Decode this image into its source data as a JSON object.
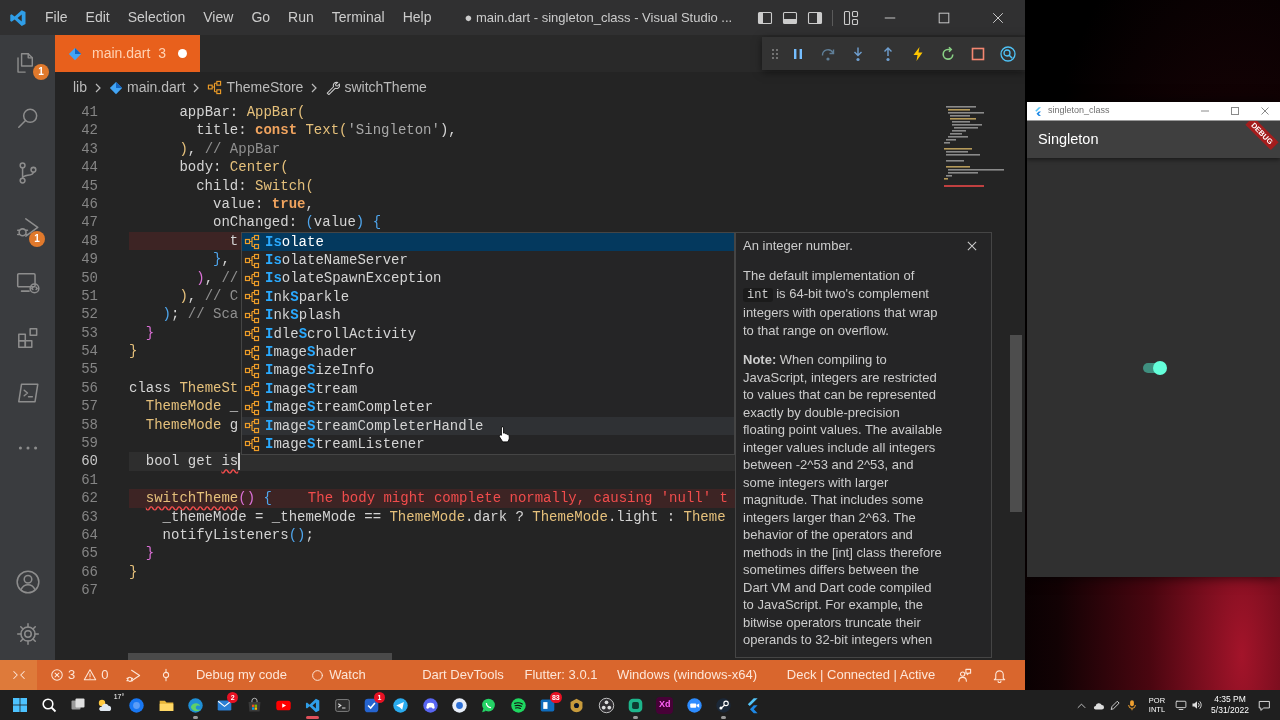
{
  "title_bar": {
    "menu": [
      "File",
      "Edit",
      "Selection",
      "View",
      "Go",
      "Run",
      "Terminal",
      "Help"
    ],
    "title": "● main.dart - singleton_class - Visual Studio ..."
  },
  "activity_bar": {
    "explorer_badge": "1",
    "debug_badge": "1"
  },
  "tabs": [
    {
      "label": "main.dart",
      "problems": "3",
      "modified": true,
      "selected": true
    }
  ],
  "breadcrumb": [
    {
      "label": "lib",
      "kind": "folder"
    },
    {
      "label": "main.dart",
      "kind": "file"
    },
    {
      "label": "ThemeStore",
      "kind": "class"
    },
    {
      "label": "switchTheme",
      "kind": "method"
    }
  ],
  "editor": {
    "lines": [
      {
        "number": "41",
        "current": false,
        "error": false,
        "tokens": [
          {
            "text": "      appBar: ",
            "kind": "plain"
          },
          {
            "text": "AppBar(",
            "kind": "type"
          }
        ]
      },
      {
        "number": "42",
        "current": false,
        "error": false,
        "tokens": [
          {
            "text": "        title: ",
            "kind": "plain"
          },
          {
            "text": "const",
            "kind": "keyword"
          },
          {
            "text": " Text(",
            "kind": "type"
          },
          {
            "text": "'Singleton'",
            "kind": "string"
          },
          {
            "text": "),",
            "kind": "plain"
          }
        ]
      },
      {
        "number": "43",
        "current": false,
        "error": false,
        "tokens": [
          {
            "text": "      )",
            "kind": "bracket_gold"
          },
          {
            "text": ", ",
            "kind": "plain"
          },
          {
            "text": "// AppBar",
            "kind": "comment"
          }
        ]
      },
      {
        "number": "44",
        "current": false,
        "error": false,
        "tokens": [
          {
            "text": "      body: ",
            "kind": "plain"
          },
          {
            "text": "Center(",
            "kind": "type"
          }
        ]
      },
      {
        "number": "45",
        "current": false,
        "error": false,
        "tokens": [
          {
            "text": "        child: ",
            "kind": "plain"
          },
          {
            "text": "Switch(",
            "kind": "type"
          }
        ]
      },
      {
        "number": "46",
        "current": false,
        "error": false,
        "tokens": [
          {
            "text": "          value: ",
            "kind": "plain"
          },
          {
            "text": "true",
            "kind": "keyword"
          },
          {
            "text": ",",
            "kind": "plain"
          }
        ]
      },
      {
        "number": "47",
        "current": false,
        "error": false,
        "tokens": [
          {
            "text": "          onChanged: ",
            "kind": "plain"
          },
          {
            "text": "(",
            "kind": "bracket_blue"
          },
          {
            "text": "value",
            "kind": "plain"
          },
          {
            "text": ") {",
            "kind": "bracket_blue"
          }
        ]
      },
      {
        "number": "48",
        "current": false,
        "error": true,
        "tokens": [
          {
            "text": "            t",
            "kind": "plain"
          }
        ]
      },
      {
        "number": "49",
        "current": false,
        "error": false,
        "tokens": [
          {
            "text": "          }",
            "kind": "bracket_blue"
          },
          {
            "text": ",",
            "kind": "plain"
          }
        ]
      },
      {
        "number": "50",
        "current": false,
        "error": false,
        "tokens": [
          {
            "text": "        )",
            "kind": "bracket_pink"
          },
          {
            "text": ", ",
            "kind": "plain"
          },
          {
            "text": "//",
            "kind": "comment"
          }
        ]
      },
      {
        "number": "51",
        "current": false,
        "error": false,
        "tokens": [
          {
            "text": "      )",
            "kind": "bracket_gold"
          },
          {
            "text": ", ",
            "kind": "plain"
          },
          {
            "text": "// C",
            "kind": "comment"
          }
        ]
      },
      {
        "number": "52",
        "current": false,
        "error": false,
        "tokens": [
          {
            "text": "    )",
            "kind": "bracket_blue"
          },
          {
            "text": "; ",
            "kind": "plain"
          },
          {
            "text": "// Sca",
            "kind": "comment"
          }
        ]
      },
      {
        "number": "53",
        "current": false,
        "error": false,
        "tokens": [
          {
            "text": "  }",
            "kind": "bracket_pink"
          }
        ]
      },
      {
        "number": "54",
        "current": false,
        "error": false,
        "tokens": [
          {
            "text": "}",
            "kind": "bracket_gold"
          }
        ]
      },
      {
        "number": "55",
        "current": false,
        "error": false
      },
      {
        "number": "56",
        "current": false,
        "error": false,
        "tokens": [
          {
            "text": "class ",
            "kind": "plain"
          },
          {
            "text": "ThemeSt",
            "kind": "type"
          }
        ]
      },
      {
        "number": "57",
        "current": false,
        "error": false,
        "tokens": [
          {
            "text": "  ThemeMode",
            "kind": "type"
          },
          {
            "text": " _",
            "kind": "plain"
          }
        ]
      },
      {
        "number": "58",
        "current": false,
        "error": false,
        "tokens": [
          {
            "text": "  ThemeMode",
            "kind": "type"
          },
          {
            "text": " g",
            "kind": "plain"
          }
        ]
      },
      {
        "number": "59",
        "current": false,
        "error": false
      },
      {
        "number": "60",
        "current": true,
        "error": false,
        "tokens": [
          {
            "text": "  bool get ",
            "kind": "plain"
          },
          {
            "text": "is",
            "kind": "error_ident"
          }
        ]
      },
      {
        "number": "61",
        "current": false,
        "error": false
      },
      {
        "number": "62",
        "current": false,
        "error": true,
        "tokens": [
          {
            "text": "  switchTheme",
            "kind": "error_call"
          },
          {
            "text": "()",
            "kind": "bracket_pink"
          },
          {
            "text": " {",
            "kind": "bracket_blue"
          }
        ],
        "diagnostic": "The body might complete normally, causing 'null' t"
      },
      {
        "number": "63",
        "current": false,
        "error": false,
        "tokens": [
          {
            "text": "    _themeMode = _themeMode == ",
            "kind": "plain"
          },
          {
            "text": "ThemeMode",
            "kind": "type"
          },
          {
            "text": ".dark ? ",
            "kind": "plain"
          },
          {
            "text": "ThemeMode",
            "kind": "type"
          },
          {
            "text": ".light : ",
            "kind": "plain"
          },
          {
            "text": "Theme",
            "kind": "type"
          }
        ]
      },
      {
        "number": "64",
        "current": false,
        "error": false,
        "tokens": [
          {
            "text": "    notifyListeners",
            "kind": "plain"
          },
          {
            "text": "()",
            "kind": "bracket_blue"
          },
          {
            "text": ";",
            "kind": "plain"
          }
        ]
      },
      {
        "number": "65",
        "current": false,
        "error": false,
        "tokens": [
          {
            "text": "  }",
            "kind": "bracket_pink"
          }
        ]
      },
      {
        "number": "66",
        "current": false,
        "error": false,
        "tokens": [
          {
            "text": "}",
            "kind": "bracket_gold"
          }
        ]
      },
      {
        "number": "67",
        "current": false,
        "error": false
      }
    ]
  },
  "suggestions": [
    {
      "label": "**Is**olate",
      "selected": true,
      "hovered": false
    },
    {
      "label": "**Is**olateNameServer",
      "selected": false,
      "hovered": false
    },
    {
      "label": "**Is**olateSpawnException",
      "selected": false,
      "hovered": false
    },
    {
      "label": "**I**nk**S**parkle",
      "selected": false,
      "hovered": false
    },
    {
      "label": "**I**nk**S**plash",
      "selected": false,
      "hovered": false
    },
    {
      "label": "**I**dle**S**crollActivity",
      "selected": false,
      "hovered": false
    },
    {
      "label": "**I**mage**S**hader",
      "selected": false,
      "hovered": false
    },
    {
      "label": "**I**mage**S**izeInfo",
      "selected": false,
      "hovered": false
    },
    {
      "label": "**I**mage**S**tream",
      "selected": false,
      "hovered": false
    },
    {
      "label": "**I**mage**S**treamCompleter",
      "selected": false,
      "hovered": false
    },
    {
      "label": "**I**mage**S**treamCompleterHandle",
      "selected": false,
      "hovered": true
    },
    {
      "label": "**I**mage**S**treamListener",
      "selected": false,
      "hovered": false
    }
  ],
  "hover_doc": {
    "title": "An integer number.",
    "paragraphs": [
      {
        "lines": [
          [
            {
              "text": "The default implementation of",
              "kind": "text"
            }
          ],
          [
            {
              "text": "int",
              "kind": "code"
            },
            {
              "text": " is 64-bit two's complement",
              "kind": "text"
            }
          ],
          [
            {
              "text": "integers with operations that wrap",
              "kind": "text"
            }
          ],
          [
            {
              "text": "to that range on overflow.",
              "kind": "text"
            }
          ]
        ]
      },
      {
        "lines": [
          [
            {
              "text": "Note:",
              "kind": "bold"
            },
            {
              "text": " When compiling to",
              "kind": "text"
            }
          ],
          [
            {
              "text": "JavaScript, integers are restricted",
              "kind": "text"
            }
          ],
          [
            {
              "text": "to values that can be represented",
              "kind": "text"
            }
          ],
          [
            {
              "text": "exactly by double-precision",
              "kind": "text"
            }
          ],
          [
            {
              "text": "floating point values. The available",
              "kind": "text"
            }
          ],
          [
            {
              "text": "integer values include all integers",
              "kind": "text"
            }
          ],
          [
            {
              "text": "between -2^53 and 2^53, and",
              "kind": "text"
            }
          ],
          [
            {
              "text": "some integers with larger",
              "kind": "text"
            }
          ],
          [
            {
              "text": "magnitude. That includes some",
              "kind": "text"
            }
          ],
          [
            {
              "text": "integers larger than 2^63. The",
              "kind": "text"
            }
          ],
          [
            {
              "text": "behavior of the operators and",
              "kind": "text"
            }
          ],
          [
            {
              "text": "methods in the [int] class therefore",
              "kind": "text"
            }
          ],
          [
            {
              "text": "sometimes differs between the",
              "kind": "text"
            }
          ],
          [
            {
              "text": "Dart VM and Dart code compiled",
              "kind": "text"
            }
          ],
          [
            {
              "text": "to JavaScript. For example, the",
              "kind": "text"
            }
          ],
          [
            {
              "text": "bitwise operators truncate their",
              "kind": "text"
            }
          ],
          [
            {
              "text": "operands to 32-bit integers when",
              "kind": "text"
            }
          ]
        ]
      }
    ]
  },
  "status_bar": {
    "errors": "3",
    "warnings": "0",
    "items": [
      {
        "text": "Debug my code",
        "kind": "plain"
      },
      {
        "text": "Watch",
        "kind": "watch"
      },
      {
        "text": "Dart DevTools",
        "kind": "plain"
      },
      {
        "text": "Flutter: 3.0.1",
        "kind": "plain"
      },
      {
        "text": "Windows (windows-x64)",
        "kind": "plain"
      },
      {
        "text": "Deck | Connected | Active",
        "kind": "plain"
      }
    ]
  },
  "app_window": {
    "title": "singleton_class",
    "app_bar_title": "Singleton",
    "debug_banner": "DEBUG",
    "switch": {
      "on": true
    }
  },
  "taskbar": {
    "weather": "17°",
    "apps": [
      {
        "selected": false,
        "running": false
      },
      {
        "selected": false,
        "running": false
      },
      {
        "selected": false,
        "running": true
      },
      {
        "selected": false,
        "running": false,
        "badge": "2"
      },
      {
        "selected": false,
        "running": false
      },
      {
        "selected": false,
        "running": false
      },
      {
        "selected": true,
        "running": true
      },
      {
        "selected": false,
        "running": false
      },
      {
        "selected": false,
        "running": false,
        "badge": "1"
      },
      {
        "selected": false,
        "running": false
      },
      {
        "selected": false,
        "running": false
      },
      {
        "selected": false,
        "running": false
      },
      {
        "selected": false,
        "running": false
      },
      {
        "selected": false,
        "running": false
      },
      {
        "selected": false,
        "running": false,
        "badge": "83"
      },
      {
        "selected": false,
        "running": false
      },
      {
        "selected": false,
        "running": false
      },
      {
        "selected": false,
        "running": true
      },
      {
        "selected": false,
        "running": false,
        "label": "Xd"
      },
      {
        "selected": false,
        "running": false
      },
      {
        "selected": false,
        "running": true
      },
      {
        "selected": false,
        "running": false
      }
    ],
    "language": "POR",
    "layout": "INTL",
    "time": "4:35 PM",
    "date": "5/31/2022"
  }
}
